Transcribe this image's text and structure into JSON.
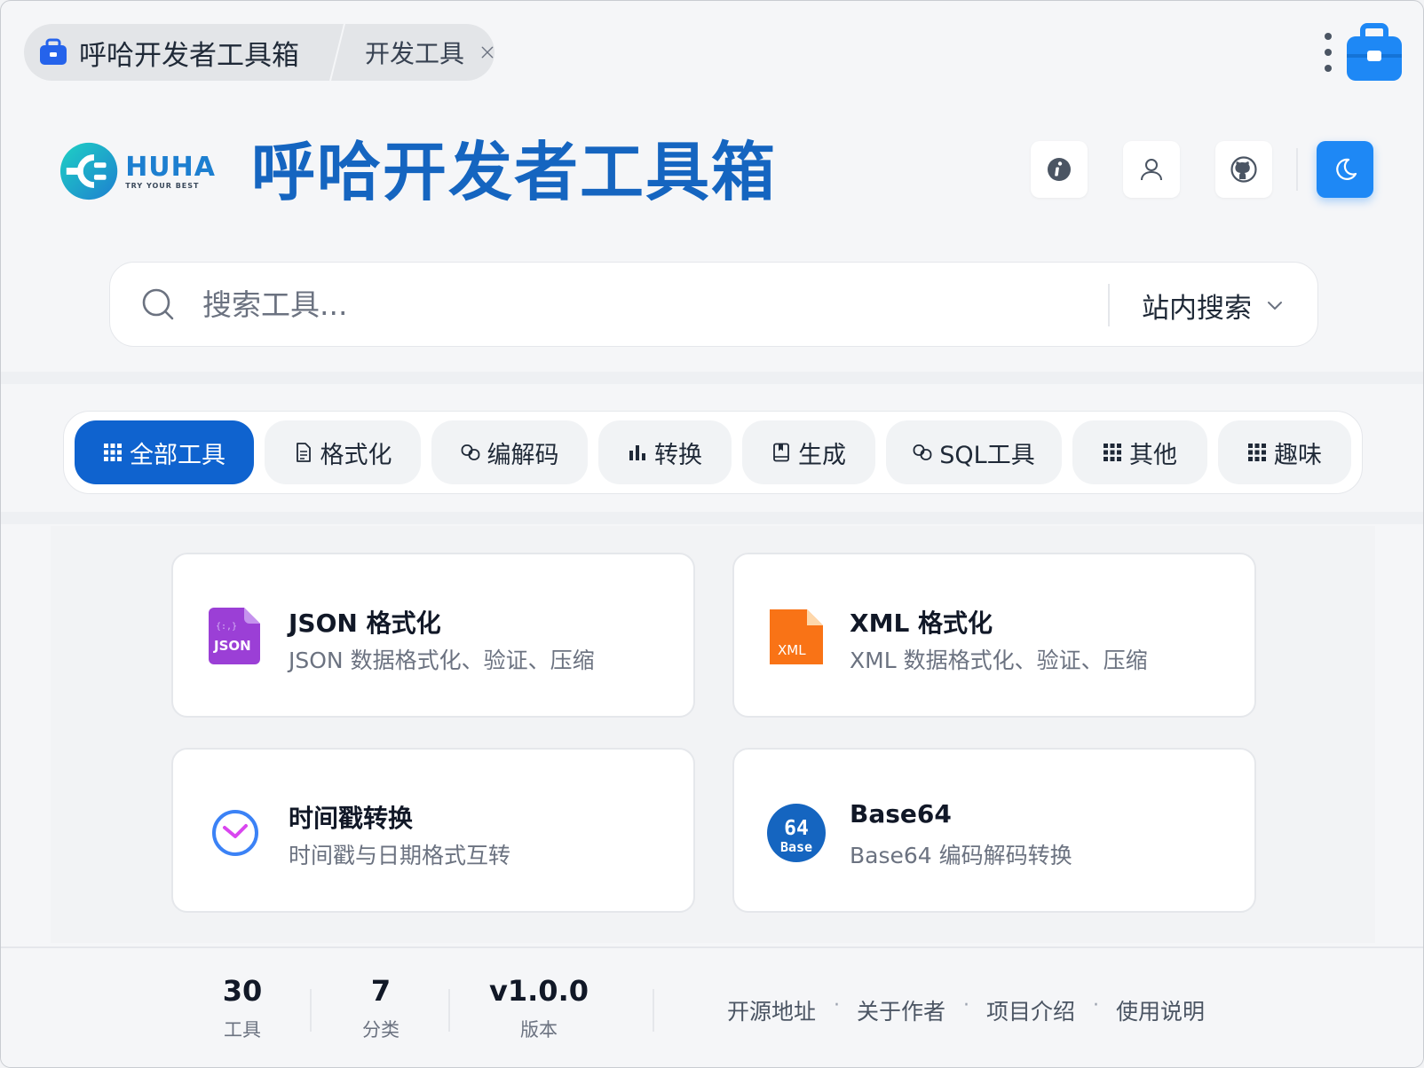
{
  "tabs": [
    {
      "label": "呼哈开发者工具箱",
      "icon": "toolbox-icon",
      "active": true
    },
    {
      "label": "开发工具",
      "icon": "close-icon",
      "active": false
    }
  ],
  "header": {
    "logo_word": "HUHA",
    "logo_tagline": "TRY YOUR BEST",
    "title": "呼哈开发者工具箱",
    "buttons": [
      {
        "name": "info-icon"
      },
      {
        "name": "user-icon"
      },
      {
        "name": "github-icon"
      },
      {
        "name": "moon-icon"
      }
    ]
  },
  "search": {
    "placeholder": "搜索工具...",
    "value": "",
    "scope_label": "站内搜索"
  },
  "categories": [
    {
      "label": "全部工具",
      "icon": "grid-icon",
      "active": true
    },
    {
      "label": "格式化",
      "icon": "document-icon",
      "active": false
    },
    {
      "label": "编解码",
      "icon": "link-icon",
      "active": false
    },
    {
      "label": "转换",
      "icon": "bar-chart-icon",
      "active": false
    },
    {
      "label": "生成",
      "icon": "book-icon",
      "active": false
    },
    {
      "label": "SQL工具",
      "icon": "link-icon",
      "active": false
    },
    {
      "label": "其他",
      "icon": "grid-icon",
      "active": false
    },
    {
      "label": "趣味",
      "icon": "grid-icon",
      "active": false
    }
  ],
  "tools": [
    {
      "title": "JSON 格式化",
      "desc": "JSON 数据格式化、验证、压缩",
      "icon": "json-file-icon",
      "icon_text": "JSON",
      "icon_subtext": "{:,}"
    },
    {
      "title": "XML 格式化",
      "desc": "XML 数据格式化、验证、压缩",
      "icon": "xml-file-icon",
      "icon_text": "XML"
    },
    {
      "title": "时间戳转换",
      "desc": "时间戳与日期格式互转",
      "icon": "clock-icon"
    },
    {
      "title": "Base64",
      "desc": "Base64 编码解码转换",
      "icon": "base64-icon",
      "icon_text": "64",
      "icon_subtext": "Base"
    }
  ],
  "stats": [
    {
      "value": "30",
      "label": "工具"
    },
    {
      "value": "7",
      "label": "分类"
    },
    {
      "value": "v1.0.0",
      "label": "版本"
    }
  ],
  "footer_links": [
    "开源地址",
    "关于作者",
    "项目介绍",
    "使用说明"
  ],
  "colors": {
    "primary": "#0f63cf",
    "title_blue": "#1565c0",
    "theme_button": "#1e88f5",
    "json_purple": "#9b3fd6",
    "xml_orange": "#f97316",
    "base64_blue": "#1565c0"
  }
}
